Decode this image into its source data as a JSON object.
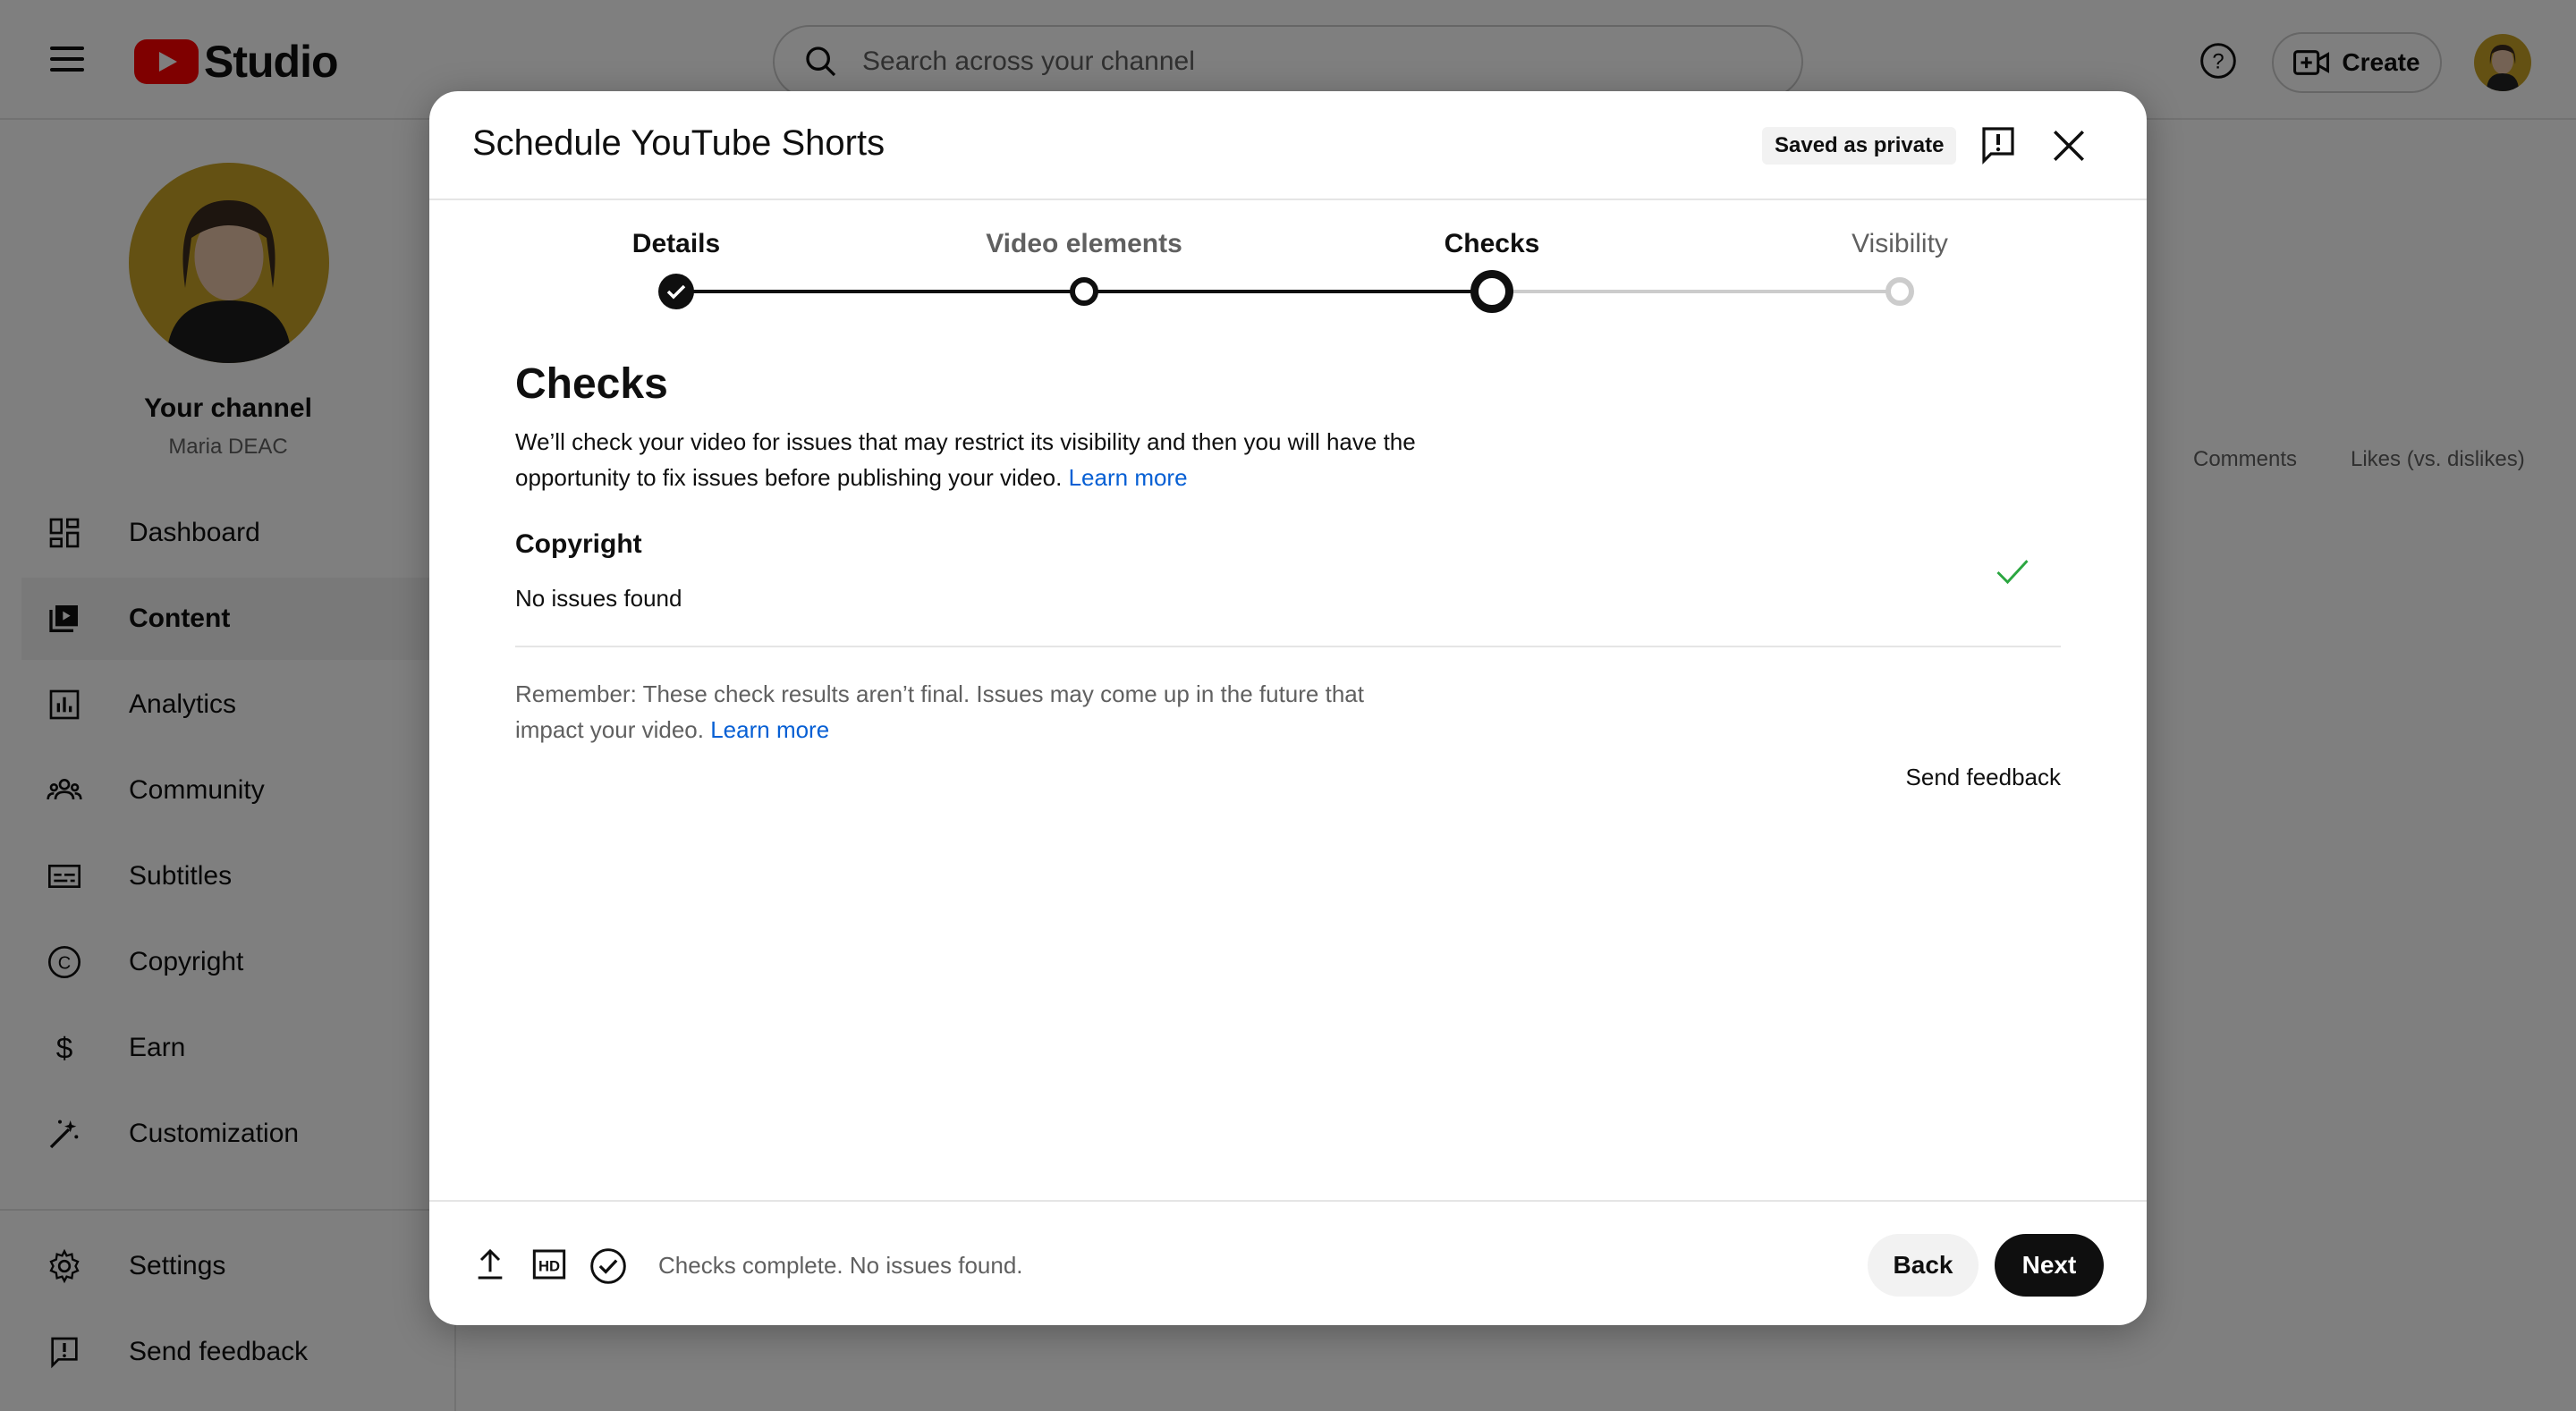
{
  "app": {
    "logo_text": "Studio",
    "search_placeholder": "Search across your channel",
    "create_label": "Create"
  },
  "sidebar": {
    "channel_title": "Your channel",
    "channel_name": "Maria DEAC",
    "items": [
      {
        "label": "Dashboard",
        "icon": "dashboard-icon"
      },
      {
        "label": "Content",
        "icon": "content-icon",
        "active": true
      },
      {
        "label": "Analytics",
        "icon": "analytics-icon"
      },
      {
        "label": "Community",
        "icon": "community-icon"
      },
      {
        "label": "Subtitles",
        "icon": "subtitles-icon"
      },
      {
        "label": "Copyright",
        "icon": "copyright-icon"
      },
      {
        "label": "Earn",
        "icon": "earn-icon"
      },
      {
        "label": "Customization",
        "icon": "customization-icon"
      }
    ],
    "bottom_items": [
      {
        "label": "Settings",
        "icon": "gear-icon"
      },
      {
        "label": "Send feedback",
        "icon": "feedback-icon"
      }
    ]
  },
  "main": {
    "column_headers": [
      "Comments",
      "Likes (vs. dislikes)"
    ]
  },
  "dialog": {
    "title": "Schedule YouTube Shorts",
    "saved_badge": "Saved as private",
    "steps": [
      {
        "label": "Details",
        "state": "done"
      },
      {
        "label": "Video elements",
        "state": "done"
      },
      {
        "label": "Checks",
        "state": "current"
      },
      {
        "label": "Visibility",
        "state": "pending"
      }
    ],
    "section_title": "Checks",
    "description": "We’ll check your video for issues that may restrict its visibility and then you will have the opportunity to fix issues before publishing your video.",
    "learn_more": "Learn more",
    "copyright_title": "Copyright",
    "copyright_status": "No issues found",
    "remember_text": "Remember: These check results aren’t final. Issues may come up in the future that impact your video.",
    "send_feedback": "Send feedback",
    "footer_status": "Checks complete. No issues found.",
    "back_label": "Back",
    "next_label": "Next"
  },
  "colors": {
    "accent_link": "#065fd4",
    "check_green": "#2ba640",
    "brand_red": "#ff0000"
  }
}
